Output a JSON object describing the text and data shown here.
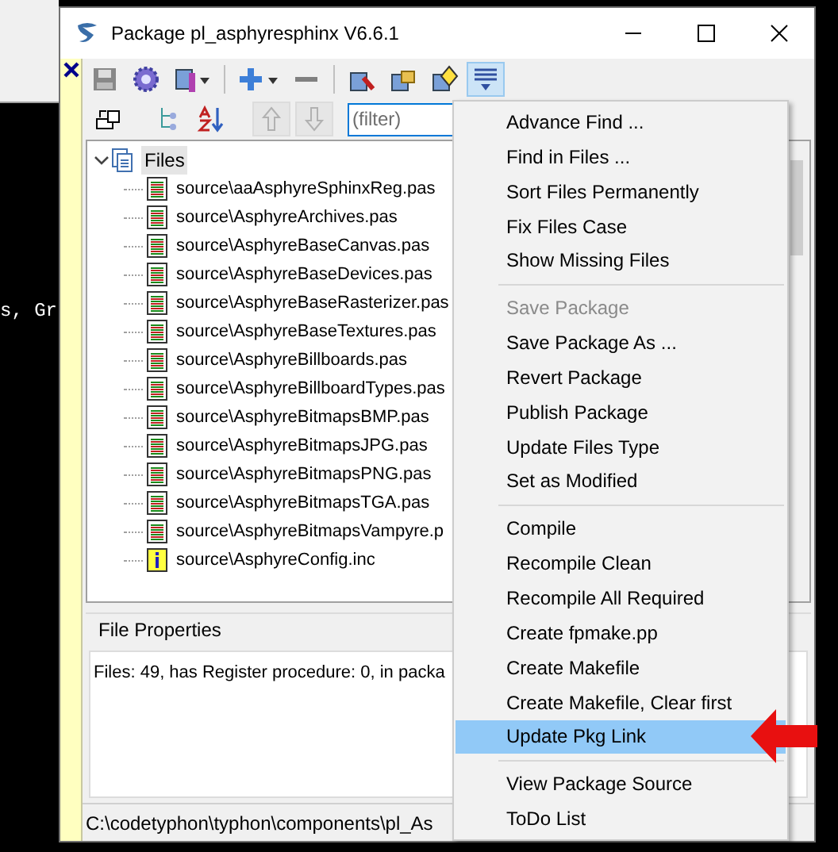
{
  "editor": {
    "text": "s, Gr"
  },
  "window": {
    "title": "Package pl_asphyresphinx V6.6.1"
  },
  "toolbar": {
    "menu_button_pressed": true
  },
  "toolbar2": {
    "move_buttons": [
      {
        "disabled": true
      },
      {
        "disabled": true
      }
    ],
    "filter": {
      "placeholder": "(filter)"
    }
  },
  "tree": {
    "root": {
      "label": "Files",
      "expanded": true,
      "selected": true,
      "children": [
        {
          "label": "source\\aaAsphyreSphinxReg.pas",
          "kind": "source"
        },
        {
          "label": "source\\AsphyreArchives.pas",
          "kind": "source"
        },
        {
          "label": "source\\AsphyreBaseCanvas.pas",
          "kind": "source"
        },
        {
          "label": "source\\AsphyreBaseDevices.pas",
          "kind": "source"
        },
        {
          "label": "source\\AsphyreBaseRasterizer.pas",
          "kind": "source"
        },
        {
          "label": "source\\AsphyreBaseTextures.pas",
          "kind": "source"
        },
        {
          "label": "source\\AsphyreBillboards.pas",
          "kind": "source"
        },
        {
          "label": "source\\AsphyreBillboardTypes.pas",
          "kind": "source"
        },
        {
          "label": "source\\AsphyreBitmapsBMP.pas",
          "kind": "source"
        },
        {
          "label": "source\\AsphyreBitmapsJPG.pas",
          "kind": "source"
        },
        {
          "label": "source\\AsphyreBitmapsPNG.pas",
          "kind": "source"
        },
        {
          "label": "source\\AsphyreBitmapsTGA.pas",
          "kind": "source"
        },
        {
          "label": "source\\AsphyreBitmapsVampyre.p",
          "kind": "source"
        },
        {
          "label": "source\\AsphyreConfig.inc",
          "kind": "include"
        }
      ]
    }
  },
  "file_properties": {
    "title": "File Properties",
    "text": "Files: 49, has Register procedure: 0, in packa"
  },
  "status_bar": {
    "text": "C:\\codetyphon\\typhon\\components\\pl_As"
  },
  "menu": {
    "items": [
      {
        "kind": "item",
        "label": "Advance Find ...",
        "disabled": false,
        "selected": false
      },
      {
        "kind": "item",
        "label": "Find in Files ...",
        "disabled": false,
        "selected": false
      },
      {
        "kind": "item",
        "label": "Sort Files Permanently",
        "disabled": false,
        "selected": false
      },
      {
        "kind": "item",
        "label": "Fix Files Case",
        "disabled": false,
        "selected": false
      },
      {
        "kind": "item",
        "label": "Show Missing Files",
        "disabled": false,
        "selected": false
      },
      {
        "kind": "separator"
      },
      {
        "kind": "item",
        "label": "Save Package",
        "disabled": true,
        "selected": false
      },
      {
        "kind": "item",
        "label": "Save Package As ...",
        "disabled": false,
        "selected": false
      },
      {
        "kind": "item",
        "label": "Revert Package",
        "disabled": false,
        "selected": false
      },
      {
        "kind": "item",
        "label": "Publish Package",
        "disabled": false,
        "selected": false
      },
      {
        "kind": "item",
        "label": "Update Files Type",
        "disabled": false,
        "selected": false
      },
      {
        "kind": "item",
        "label": "Set as Modified",
        "disabled": false,
        "selected": false
      },
      {
        "kind": "separator"
      },
      {
        "kind": "item",
        "label": "Compile",
        "disabled": false,
        "selected": false
      },
      {
        "kind": "item",
        "label": "Recompile Clean",
        "disabled": false,
        "selected": false
      },
      {
        "kind": "item",
        "label": "Recompile All Required",
        "disabled": false,
        "selected": false
      },
      {
        "kind": "item",
        "label": "Create fpmake.pp",
        "disabled": false,
        "selected": false
      },
      {
        "kind": "item",
        "label": "Create Makefile",
        "disabled": false,
        "selected": false
      },
      {
        "kind": "item",
        "label": "Create Makefile, Clear first",
        "disabled": false,
        "selected": false
      },
      {
        "kind": "item",
        "label": "Update Pkg Link",
        "disabled": false,
        "selected": true
      },
      {
        "kind": "separator"
      },
      {
        "kind": "item",
        "label": "View Package Source",
        "disabled": false,
        "selected": false
      },
      {
        "kind": "item",
        "label": "ToDo List",
        "disabled": false,
        "selected": false
      }
    ]
  }
}
